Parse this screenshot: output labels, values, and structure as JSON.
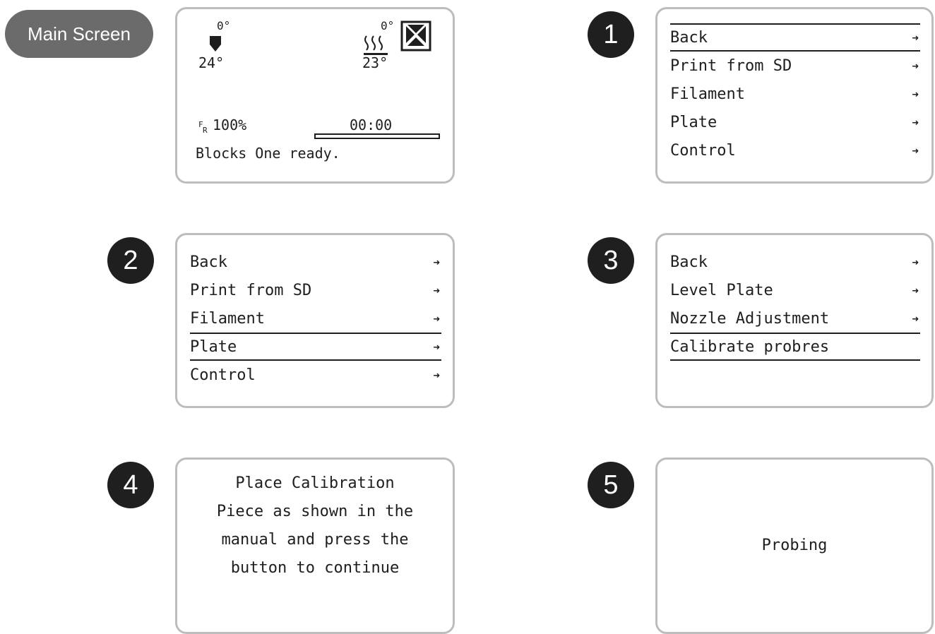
{
  "main_screen": {
    "label": "Main Screen",
    "nozzle_target": "0°",
    "nozzle_current": "24°",
    "bed_target": "0°",
    "bed_current": "23°",
    "feedrate": "100%",
    "time": "00:00",
    "status": "Blocks One ready.",
    "progress": 0
  },
  "steps": [
    {
      "number": "1",
      "items": [
        "Back",
        "Print from SD",
        "Filament",
        "Plate",
        "Control"
      ],
      "arrow": "➜"
    },
    {
      "number": "2",
      "items": [
        "Back",
        "Print from SD",
        "Filament",
        "Plate",
        "Control"
      ],
      "arrow": "➜"
    },
    {
      "number": "3",
      "items": [
        "Back",
        "Level Plate",
        "Nozzle Adjustment",
        "Calibrate probres"
      ],
      "arrow": "➜"
    },
    {
      "number": "4",
      "lines": [
        "Place Calibration",
        "Piece as shown in the",
        "manual and press the",
        "button to continue"
      ]
    },
    {
      "number": "5",
      "text": "Probing"
    }
  ]
}
